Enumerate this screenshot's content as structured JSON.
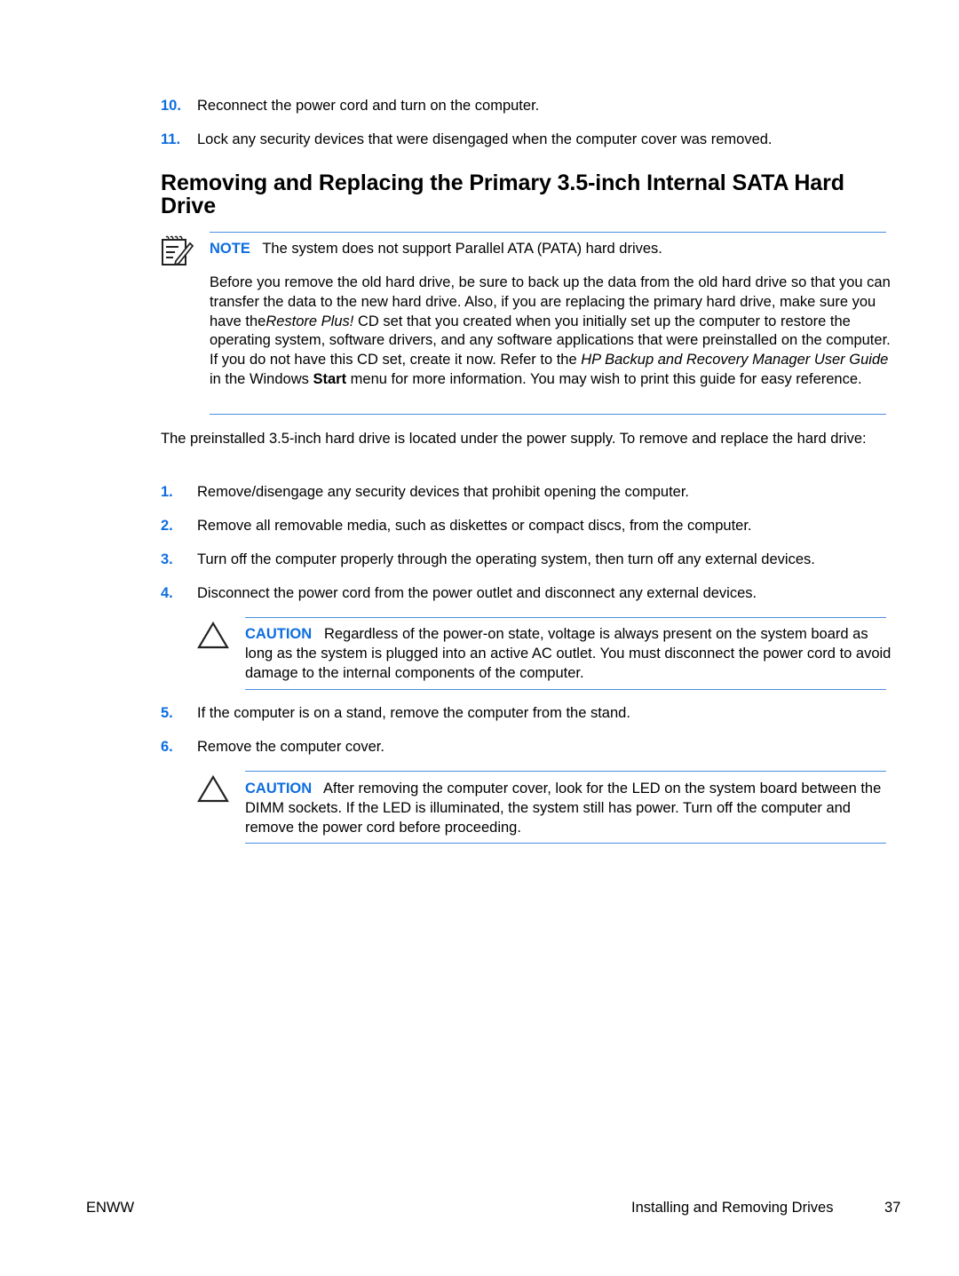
{
  "pre_steps": [
    {
      "num": "10.",
      "text": "Reconnect the power cord and turn on the computer."
    },
    {
      "num": "11.",
      "text": "Lock any security devices that were disengaged when the computer cover was removed."
    }
  ],
  "section": {
    "heading": "Removing and Replacing the Primary 3.5-inch Internal SATA Hard Drive"
  },
  "note": {
    "icon": "note-pencil-icon",
    "label": "NOTE",
    "text": "The system does not support Parallel ATA (PATA) hard drives.",
    "para": {
      "p1": "Before you remove the old hard drive, be sure to back up the data from the old hard drive so that you can transfer the data to the new hard drive. Also, if you are replacing the primary hard drive, make sure you have the",
      "italic1": "Restore Plus!",
      "p2": " CD set that you created when you initially set up the computer to restore the operating system, software drivers, and any software applications that were preinstalled on the computer. If you do not have this CD set, create it now. Refer to the ",
      "italic2": "HP Backup and Recovery Manager User Guide",
      "p3": " in the Windows ",
      "bold1": "Start",
      "p4": " menu for more information. You may wish to print this guide for easy reference."
    }
  },
  "intro": "The preinstalled 3.5-inch hard drive is located under the power supply. To remove and replace the hard drive:",
  "steps_a": [
    {
      "num": "1.",
      "text": "Remove/disengage any security devices that prohibit opening the computer."
    },
    {
      "num": "2.",
      "text": "Remove all removable media, such as diskettes or compact discs, from the computer."
    },
    {
      "num": "3.",
      "text": "Turn off the computer properly through the operating system, then turn off any external devices."
    },
    {
      "num": "4.",
      "text": "Disconnect the power cord from the power outlet and disconnect any external devices."
    }
  ],
  "caution1": {
    "icon": "caution-triangle-icon",
    "label": "CAUTION",
    "text": "Regardless of the power-on state, voltage is always present on the system board as long as the system is plugged into an active AC outlet. You must disconnect the power cord to avoid damage to the internal components of the computer."
  },
  "steps_b": [
    {
      "num": "5.",
      "text": "If the computer is on a stand, remove the computer from the stand."
    },
    {
      "num": "6.",
      "text": "Remove the computer cover."
    }
  ],
  "caution2": {
    "icon": "caution-triangle-icon",
    "label": "CAUTION",
    "text": "After removing the computer cover, look for the LED on the system board between the DIMM sockets. If the LED is illuminated, the system still has power. Turn off the computer and remove the power cord before proceeding."
  },
  "footer": {
    "left": "ENWW",
    "section": "Installing and Removing Drives",
    "page": "37"
  },
  "colors": {
    "accent": "#0d6ee0",
    "rule": "#4a8fe0"
  }
}
